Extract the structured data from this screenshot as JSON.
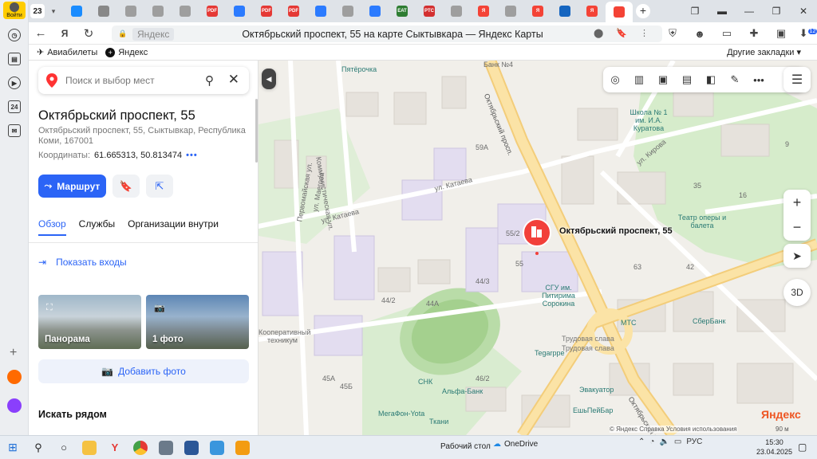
{
  "rail": {
    "login_label": "Войти",
    "icons": [
      "clock-icon",
      "collections-icon",
      "play-icon",
      "twentyfour-icon",
      "messenger-icon"
    ],
    "badge_24": "24"
  },
  "tabs": {
    "count": "23",
    "favicons": [
      {
        "name": "cloud-tab",
        "color": "#1a8cff",
        "text": ""
      },
      {
        "name": "doc-tab",
        "color": "#888888",
        "text": ""
      },
      {
        "name": "sheet-tab",
        "color": "#9e9e9e",
        "text": ""
      },
      {
        "name": "sheet-tab",
        "color": "#9e9e9e",
        "text": ""
      },
      {
        "name": "sheet-tab",
        "color": "#9e9e9e",
        "text": ""
      },
      {
        "name": "pdf-tab",
        "color": "#e53935",
        "text": "PDF"
      },
      {
        "name": "mail-tab",
        "color": "#2b7bff",
        "text": ""
      },
      {
        "name": "pdf-tab",
        "color": "#e53935",
        "text": "PDF"
      },
      {
        "name": "pdf-tab",
        "color": "#e53935",
        "text": "PDF"
      },
      {
        "name": "mail-tab",
        "color": "#2b7bff",
        "text": ""
      },
      {
        "name": "sheet-tab",
        "color": "#9e9e9e",
        "text": ""
      },
      {
        "name": "mail-tab",
        "color": "#2b7bff",
        "text": ""
      },
      {
        "name": "eat-tab",
        "color": "#2e7d32",
        "text": "EAT"
      },
      {
        "name": "rtc-tab",
        "color": "#d32f2f",
        "text": "PTC"
      },
      {
        "name": "sheet-tab",
        "color": "#9e9e9e",
        "text": ""
      },
      {
        "name": "yandex-tab",
        "color": "#f44336",
        "text": "Я"
      },
      {
        "name": "sheet-tab",
        "color": "#9e9e9e",
        "text": ""
      },
      {
        "name": "yandex-tab",
        "color": "#f44336",
        "text": "Я"
      },
      {
        "name": "gerb-tab",
        "color": "#1565c0",
        "text": ""
      },
      {
        "name": "yandex-tab",
        "color": "#f44336",
        "text": "Я"
      },
      {
        "name": "maps-tab",
        "color": "#f44336",
        "text": ""
      }
    ]
  },
  "address_bar": {
    "domain": "Яндекс",
    "title": "Октябрьский проспект, 55 на карте Сыктывкара — Яндекс Карты",
    "downloads_badge": "12"
  },
  "bookmarks": {
    "items": [
      "Авиабилеты",
      "Яндекс"
    ],
    "other": "Другие закладки"
  },
  "panel": {
    "search_placeholder": "Поиск и выбор мест",
    "title": "Октябрьский проспект, 55",
    "address": "Октябрьский проспект, 55, Сыктывкар, Республика Коми, 167001",
    "coords_label": "Координаты:",
    "coords_value": "61.665313, 50.813474",
    "route_label": "Маршрут",
    "tabs": [
      "Обзор",
      "Службы",
      "Организации внутри"
    ],
    "show_entrances": "Показать входы",
    "photos": [
      "Панорама",
      "1 фото"
    ],
    "add_photo": "Добавить фото",
    "nearby": "Искать рядом"
  },
  "map": {
    "marker_label": "Октябрьский проспект, 55",
    "streets": [
      "Октябрьский просп.",
      "ул. Катаева",
      "ул. Катаева",
      "ул. Маегова",
      "Первомайская ул.",
      "Коммунистическая ул.",
      "ул. Кирова",
      "Октябрьский просп.",
      "Трудовая слава"
    ],
    "numbers": [
      "59А",
      "55",
      "44/3",
      "44/2",
      "44А",
      "45Б",
      "45А",
      "46/2",
      "63",
      "42",
      "55/2",
      "35",
      "16",
      "9"
    ],
    "pois": [
      "Пятёрочка",
      "Школа № 1 им. И.А. Куратова",
      "Театр оперы и балета",
      "СГУ им. Питирима Сорокина",
      "МТС",
      "СберБанк",
      "Tegarppe",
      "Трудовая слава",
      "СНК",
      "Альфа-Банк",
      "МегаФон-Yota",
      "Ткани",
      "Эвакуатор",
      "ЕшьПейБар",
      "Кооперативный техникум",
      "Банк №4"
    ],
    "logo": "Яндекс",
    "copyright": "© Яндекс  Справка  Условия использования",
    "scale": "90 м",
    "btn_3d": "3D"
  },
  "taskbar": {
    "desktop": "Рабочий стол",
    "onedrive": "OneDrive",
    "lang": "РУС",
    "time": "15:30",
    "date": "23.04.2025"
  }
}
